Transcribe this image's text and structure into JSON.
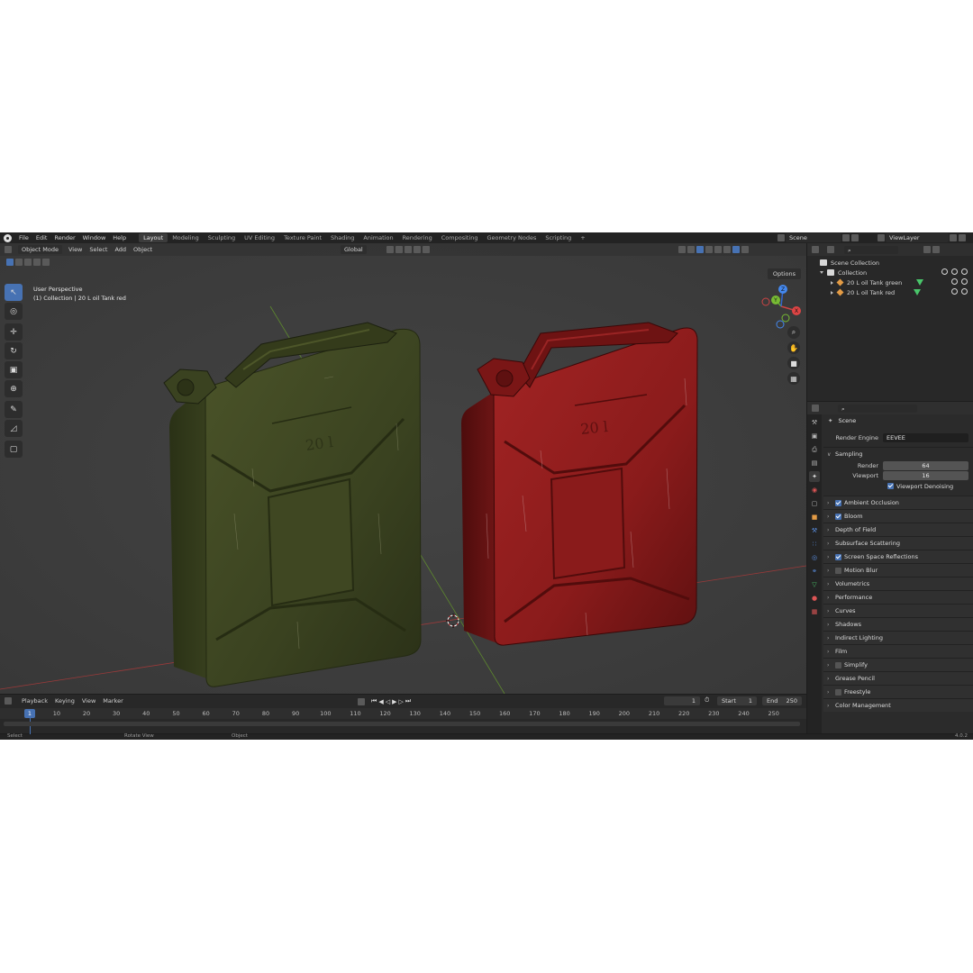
{
  "topbar": {
    "menus": [
      "File",
      "Edit",
      "Render",
      "Window",
      "Help"
    ],
    "workspaces": [
      "Layout",
      "Modeling",
      "Sculpting",
      "UV Editing",
      "Texture Paint",
      "Shading",
      "Animation",
      "Rendering",
      "Compositing",
      "Geometry Nodes",
      "Scripting"
    ],
    "active_workspace": "Layout",
    "add_tab": "+",
    "scene": "Scene",
    "view_layer": "ViewLayer"
  },
  "viewport": {
    "mode": "Object Mode",
    "menus": [
      "View",
      "Select",
      "Add",
      "Object"
    ],
    "transform_orientation": "Global",
    "options": "Options",
    "perspective": "User Perspective",
    "active_info": "(1) Collection | 20 L oil Tank red",
    "objects": [
      {
        "name": "green jerrycan",
        "color": "#3f4a22",
        "stamp": "20 l"
      },
      {
        "name": "red jerrycan",
        "color": "#8a1a1a",
        "stamp": "20 l"
      }
    ],
    "gizmo_axes": [
      "X",
      "Y",
      "Z"
    ]
  },
  "timeline": {
    "menus": [
      "Playback",
      "Keying",
      "View",
      "Marker"
    ],
    "current_frame": "1",
    "start_label": "Start",
    "start": "1",
    "end_label": "End",
    "end": "250",
    "ticks": [
      "1",
      "10",
      "20",
      "30",
      "40",
      "50",
      "60",
      "70",
      "80",
      "90",
      "100",
      "110",
      "120",
      "130",
      "140",
      "150",
      "160",
      "170",
      "180",
      "190",
      "200",
      "210",
      "220",
      "230",
      "240",
      "250"
    ]
  },
  "statusbar": {
    "select": "Select",
    "rotate": "Rotate View",
    "object": "Object",
    "version": "4.0.2"
  },
  "outliner": {
    "scene_collection": "Scene Collection",
    "collection": "Collection",
    "items": [
      "20 L oil Tank green",
      "20 L oil Tank red"
    ]
  },
  "properties": {
    "context": "Scene",
    "render_engine_label": "Render Engine",
    "render_engine": "EEVEE",
    "sampling": {
      "title": "Sampling",
      "render_label": "Render",
      "render": "64",
      "viewport_label": "Viewport",
      "viewport": "16",
      "denoise": "Viewport Denoising"
    },
    "panels": [
      {
        "label": "Ambient Occlusion",
        "checkbox": true,
        "checked": true
      },
      {
        "label": "Bloom",
        "checkbox": true,
        "checked": true
      },
      {
        "label": "Depth of Field",
        "checkbox": false,
        "checked": false
      },
      {
        "label": "Subsurface Scattering",
        "checkbox": false,
        "checked": false
      },
      {
        "label": "Screen Space Reflections",
        "checkbox": true,
        "checked": true
      },
      {
        "label": "Motion Blur",
        "checkbox": true,
        "checked": false
      },
      {
        "label": "Volumetrics",
        "checkbox": false,
        "checked": false
      },
      {
        "label": "Performance",
        "checkbox": false,
        "checked": false
      },
      {
        "label": "Curves",
        "checkbox": false,
        "checked": false
      },
      {
        "label": "Shadows",
        "checkbox": false,
        "checked": false
      },
      {
        "label": "Indirect Lighting",
        "checkbox": false,
        "checked": false
      },
      {
        "label": "Film",
        "checkbox": false,
        "checked": false
      },
      {
        "label": "Simplify",
        "checkbox": true,
        "checked": false
      },
      {
        "label": "Grease Pencil",
        "checkbox": false,
        "checked": false
      },
      {
        "label": "Freestyle",
        "checkbox": true,
        "checked": false
      },
      {
        "label": "Color Management",
        "checkbox": false,
        "checked": false
      }
    ]
  }
}
